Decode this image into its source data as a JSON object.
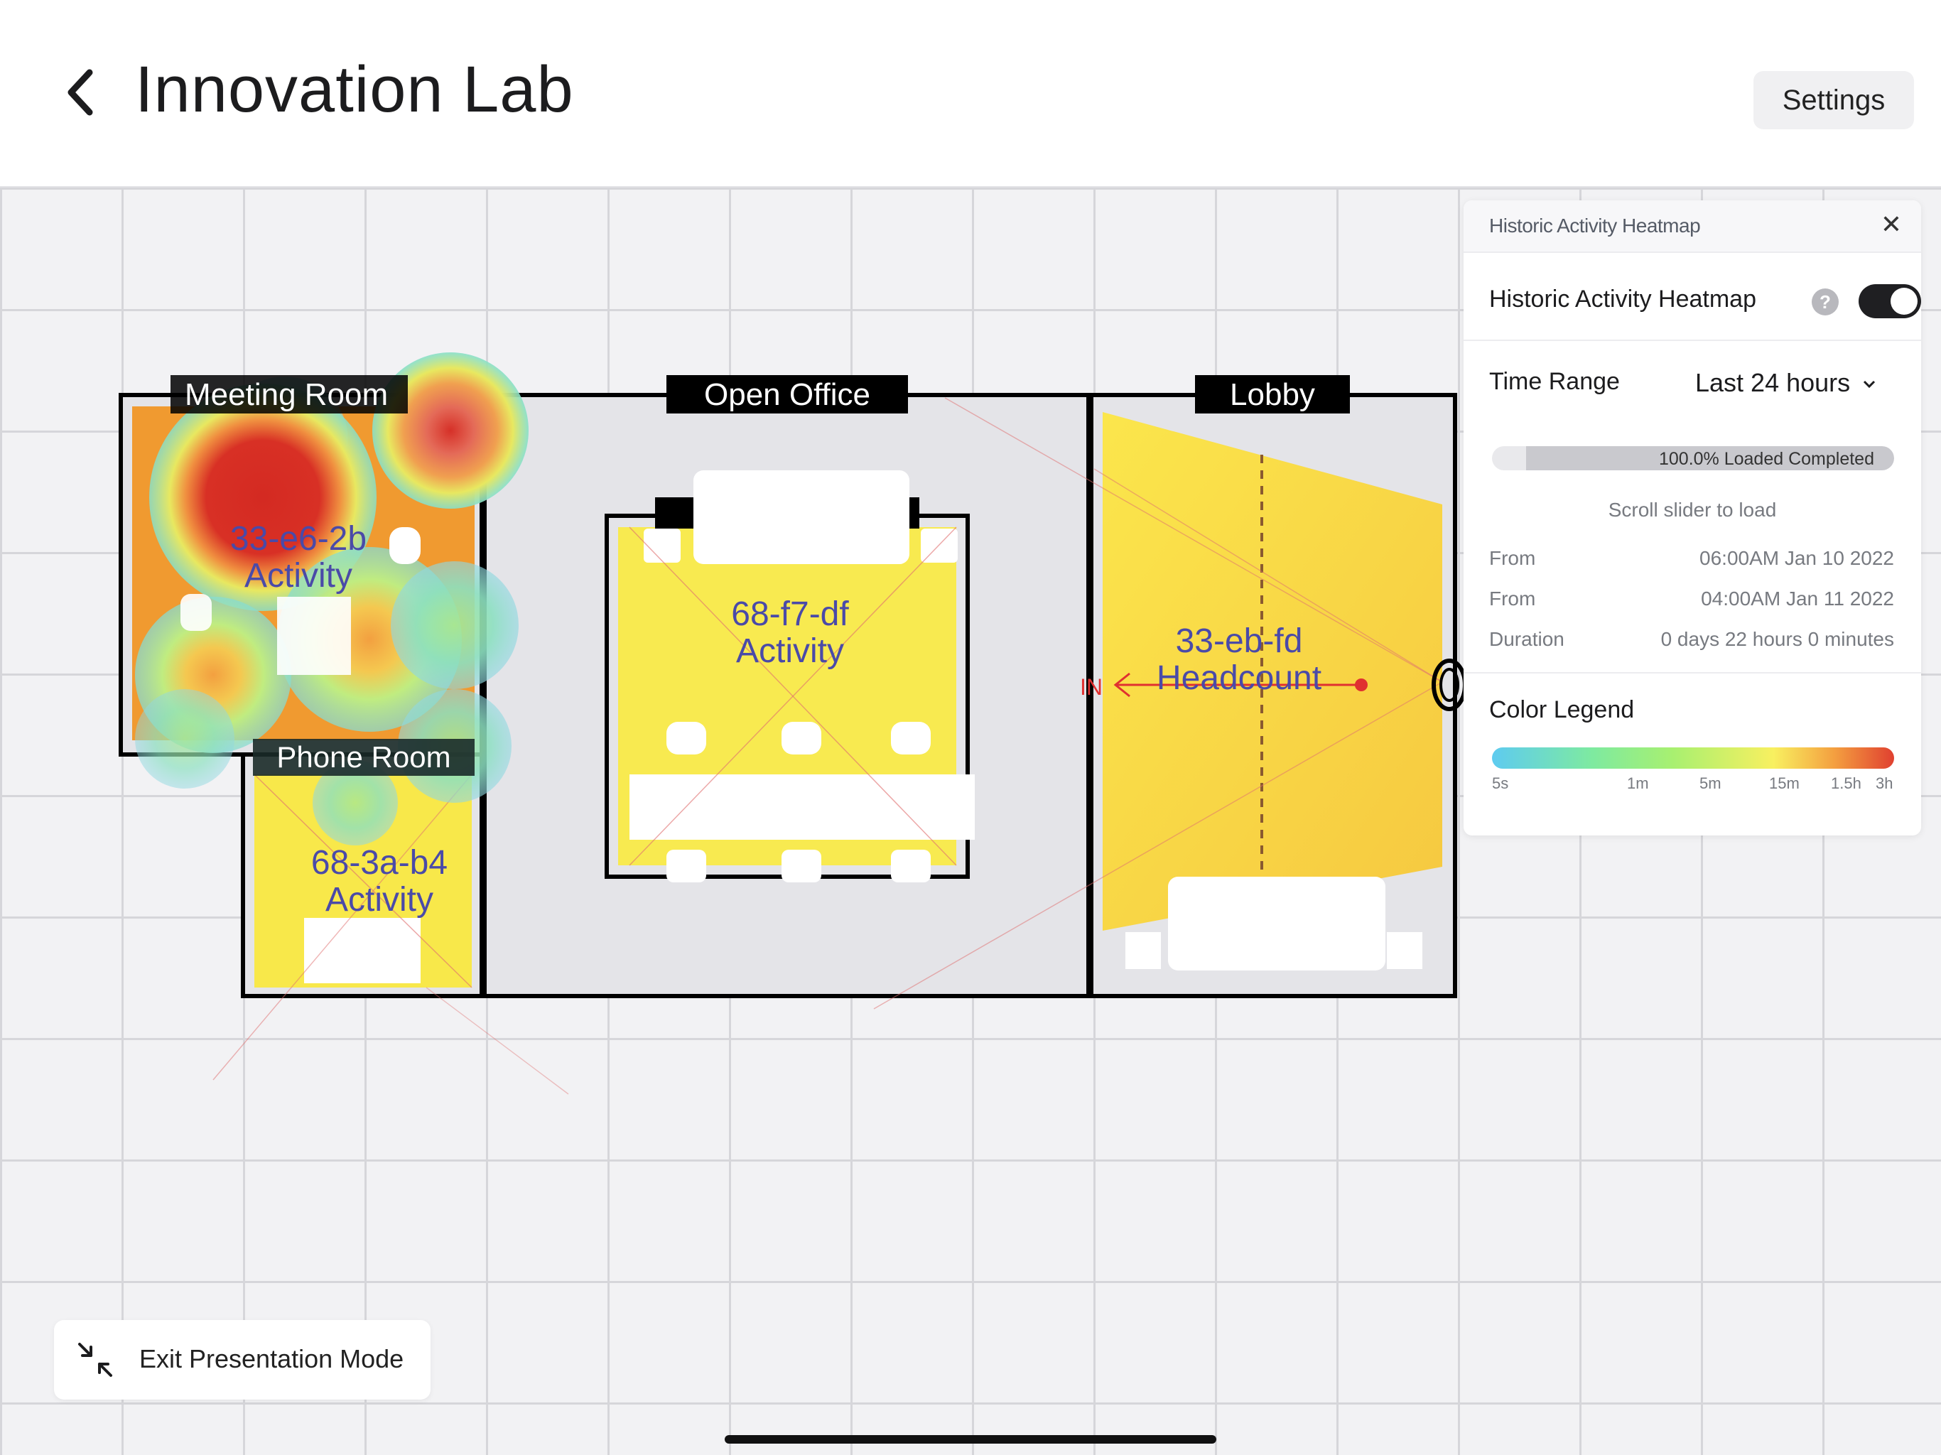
{
  "header": {
    "title": "Innovation Lab",
    "settings_label": "Settings",
    "back_icon": "chevron-left-icon"
  },
  "floorplan": {
    "rooms": [
      {
        "name": "Meeting Room"
      },
      {
        "name": "Open Office"
      },
      {
        "name": "Lobby"
      },
      {
        "name": "Phone Room"
      }
    ],
    "sensors": [
      {
        "id": "33-e6-2b",
        "type": "Activity"
      },
      {
        "id": "68-f7-df",
        "type": "Activity"
      },
      {
        "id": "68-3a-b4",
        "type": "Activity"
      },
      {
        "id": "33-eb-fd",
        "type": "Headcount"
      }
    ],
    "in_label": "IN",
    "colors": {
      "heat_hot": "#d83025",
      "heat_warm": "#f4a040",
      "heat_low": "#f8ee5a",
      "heat_cool": "#8fe6b0",
      "room_fill": "#e4e4e8",
      "room_label_bg": "#000000",
      "sensor_text": "#4a4aa8",
      "in_line": "#e03030"
    }
  },
  "panel": {
    "header_title": "Historic Activity Heatmap",
    "toggle_label": "Historic Activity Heatmap",
    "toggle_on": true,
    "time_range_label": "Time Range",
    "time_range_value": "Last 24 hours",
    "progress_text": "100.0% Loaded Completed",
    "progress_value": 1.0,
    "scroll_hint": "Scroll slider to load",
    "info": [
      {
        "key": "From",
        "value": "06:00AM Jan 10 2022"
      },
      {
        "key": "From",
        "value": "04:00AM Jan 11 2022"
      },
      {
        "key": "Duration",
        "value": "0 days 22 hours 0 minutes"
      }
    ],
    "legend_title": "Color Legend",
    "legend_ticks": [
      "5s",
      "1m",
      "5m",
      "15m",
      "1.5h",
      "3h"
    ]
  },
  "footer": {
    "exit_label": "Exit Presentation Mode",
    "exit_icon": "collapse-arrows-icon"
  }
}
